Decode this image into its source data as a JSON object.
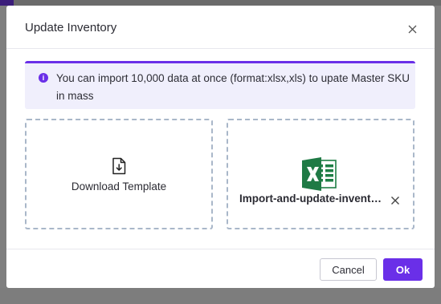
{
  "modal": {
    "title": "Update Inventory",
    "close_icon": "close-icon"
  },
  "notice": {
    "icon": "info-icon",
    "icon_glyph": "i",
    "text": "You can import 10,000 data at once (format:xlsx,xls) to upate Master SKU in mass",
    "accent_color": "#6a2fe8"
  },
  "download_template": {
    "icon": "download-file-icon",
    "label": "Download Template"
  },
  "uploaded_file": {
    "icon": "excel-file-icon",
    "name": "Import-and-update-inventory",
    "remove_icon": "remove-file-icon"
  },
  "footer": {
    "cancel_label": "Cancel",
    "ok_label": "Ok"
  },
  "colors": {
    "primary": "#6a2fe8",
    "excel_green": "#1e7f45",
    "dashed_border": "#a9b7c9"
  }
}
